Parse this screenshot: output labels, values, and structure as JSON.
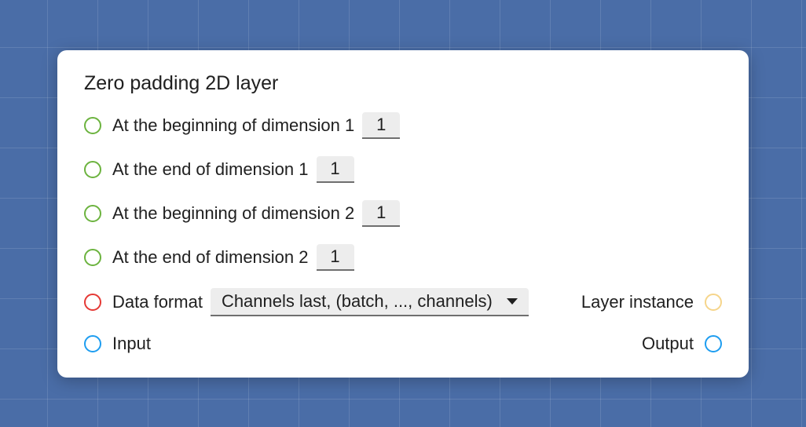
{
  "title": "Zero padding 2D layer",
  "rows": {
    "dim1_begin": {
      "label": "At the beginning of dimension 1",
      "value": "1"
    },
    "dim1_end": {
      "label": "At the end of dimension 1",
      "value": "1"
    },
    "dim2_begin": {
      "label": "At the beginning of dimension 2",
      "value": "1"
    },
    "dim2_end": {
      "label": "At the end of dimension 2",
      "value": "1"
    }
  },
  "data_format": {
    "label": "Data format",
    "selected": "Channels last, (batch, ..., channels)"
  },
  "layer_instance_label": "Layer instance",
  "input_label": "Input",
  "output_label": "Output"
}
